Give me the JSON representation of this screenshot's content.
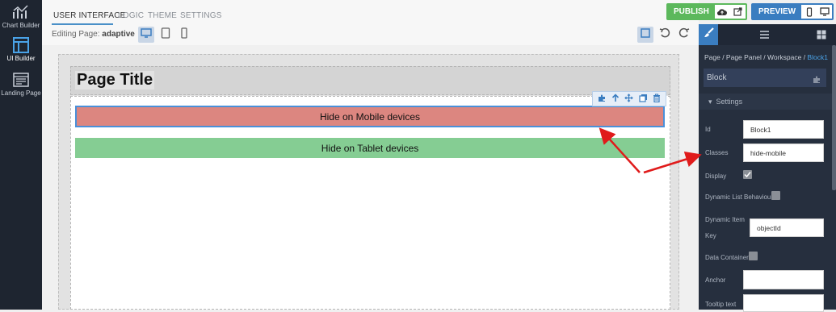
{
  "leftnav": {
    "items": [
      {
        "label": "Chart Builder",
        "icon": "chart-icon"
      },
      {
        "label": "UI Builder",
        "icon": "layout-icon"
      },
      {
        "label": "Landing Page",
        "icon": "landing-page-icon"
      }
    ]
  },
  "topbar": {
    "tabs": [
      {
        "label": "USER INTERFACE"
      },
      {
        "label": "LOGIC"
      },
      {
        "label": "THEME"
      },
      {
        "label": "SETTINGS"
      }
    ],
    "editing_prefix": "Editing Page:",
    "editing_page": "adaptive",
    "publish_label": "PUBLISH",
    "preview_label": "PREVIEW"
  },
  "canvas": {
    "page_title": "Page Title",
    "block1_text": "Hide on Mobile devices",
    "block2_text": "Hide on Tablet devices"
  },
  "panel": {
    "crumb": {
      "base": "Page / Page Panel / Workspace / ",
      "current": "Block1"
    },
    "component": "Block",
    "section": "Settings",
    "fields": {
      "id_label": "Id",
      "id_value": "Block1",
      "classes_label": "Classes",
      "classes_value": "hide-mobile",
      "display_label": "Display",
      "dynamic_list_label": "Dynamic List Behaviour",
      "dynamic_item_key_label_1": "Dynamic Item",
      "dynamic_item_key_label_2": "Key",
      "dynamic_item_key_value": "objectId",
      "data_container_label": "Data Container",
      "anchor_label": "Anchor",
      "tooltip_label": "Tooltip text"
    },
    "display_checked": true,
    "dynamic_list_checked": false,
    "data_container_checked": false
  },
  "colors": {
    "accent_blue": "#3a7dc0",
    "publish_green": "#5cb85c",
    "mobile_block": "#dc8680",
    "tablet_block": "#85cd93",
    "annotation_arrow": "#e01b1b"
  }
}
